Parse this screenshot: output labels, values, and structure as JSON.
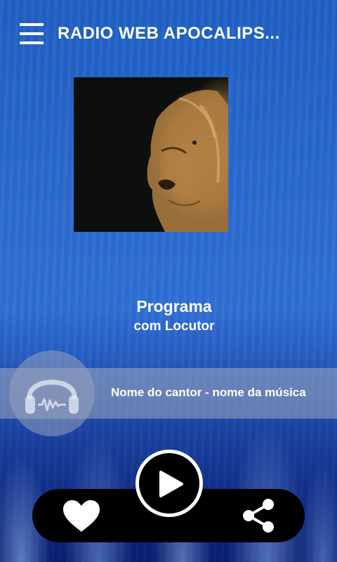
{
  "app": {
    "title": "RADIO WEB APOCALIPS..."
  },
  "program": {
    "name": "Programa",
    "host": "com Locutor"
  },
  "now_playing": {
    "text": "Nome do cantor - nome da música"
  },
  "icons": {
    "menu": "hamburger-menu-icon",
    "disc": "headphones-icon",
    "like": "heart-icon",
    "play": "play-icon",
    "share": "share-icon"
  },
  "colors": {
    "accent": "#2a6ad0",
    "bar": "#000000"
  }
}
